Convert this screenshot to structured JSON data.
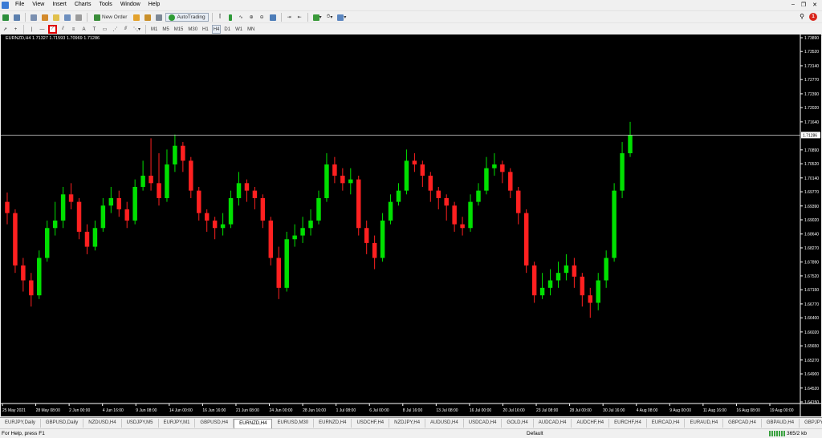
{
  "menu": [
    "File",
    "View",
    "Insert",
    "Charts",
    "Tools",
    "Window",
    "Help"
  ],
  "toolbar": {
    "new_order": "New Order",
    "autotrading": "AutoTrading"
  },
  "timeframes": [
    "M1",
    "M5",
    "M15",
    "M30",
    "H1",
    "H4",
    "D1",
    "W1",
    "MN"
  ],
  "chart": {
    "header": "EURNZD,H4  1.71327 1.71593 1.70969 1.71286",
    "current_price_label": "1.71286",
    "current_price": 1.71286,
    "colors": {
      "bull": "#00e000",
      "bear": "#ff2020",
      "line": "#d9d9d9",
      "bg": "#000000"
    }
  },
  "notifications": {
    "count": "1"
  },
  "chart_data": {
    "type": "candlestick",
    "ylim": [
      1.6415,
      1.7389
    ],
    "y_ticks": [
      "1.73890",
      "1.73520",
      "1.73140",
      "1.72770",
      "1.72390",
      "1.72020",
      "1.71640",
      "1.70890",
      "1.70520",
      "1.70140",
      "1.69770",
      "1.69390",
      "1.69020",
      "1.68640",
      "1.68270",
      "1.67890",
      "1.67520",
      "1.67150",
      "1.66770",
      "1.66400",
      "1.66020",
      "1.65650",
      "1.65270",
      "1.64900",
      "1.64520",
      "1.64150"
    ],
    "x_ticks": [
      "25 May 2021",
      "28 May 08:00",
      "2 Jun 00:00",
      "4 Jun 16:00",
      "9 Jun 08:00",
      "14 Jun 00:00",
      "16 Jun 16:00",
      "21 Jun 08:00",
      "24 Jun 00:00",
      "28 Jun 16:00",
      "1 Jul 08:00",
      "6 Jul 00:00",
      "8 Jul 16:00",
      "13 Jul 08:00",
      "16 Jul 00:00",
      "20 Jul 16:00",
      "23 Jul 08:00",
      "28 Jul 00:00",
      "30 Jul 16:00",
      "4 Aug 08:00",
      "9 Aug 00:00",
      "11 Aug 16:00",
      "16 Aug 08:00",
      "19 Aug 00:00"
    ],
    "closes": [
      1.692,
      1.678,
      1.674,
      1.67,
      1.68,
      1.688,
      1.69,
      1.697,
      1.695,
      1.687,
      1.683,
      1.688,
      1.694,
      1.696,
      1.693,
      1.69,
      1.699,
      1.702,
      1.7,
      1.696,
      1.705,
      1.71,
      1.706,
      1.698,
      1.692,
      1.69,
      1.688,
      1.689,
      1.696,
      1.7,
      1.698,
      1.696,
      1.69,
      1.68,
      1.672,
      1.685,
      1.686,
      1.688,
      1.69,
      1.696,
      1.705,
      1.702,
      1.7,
      1.701,
      1.688,
      1.684,
      1.68,
      1.69,
      1.695,
      1.698,
      1.706,
      1.705,
      1.702,
      1.698,
      1.696,
      1.694,
      1.689,
      1.688,
      1.695,
      1.698,
      1.704,
      1.705,
      1.703,
      1.698,
      1.692,
      1.678,
      1.67,
      1.672,
      1.674,
      1.676,
      1.678,
      1.675,
      1.67,
      1.668,
      1.674,
      1.68,
      1.698,
      1.708,
      1.7128
    ],
    "candles": [
      [
        1.695,
        1.692,
        1.6975,
        1.689
      ],
      [
        1.692,
        1.678,
        1.693,
        1.676
      ],
      [
        1.678,
        1.674,
        1.68,
        1.671
      ],
      [
        1.674,
        1.67,
        1.676,
        1.667
      ],
      [
        1.67,
        1.68,
        1.682,
        1.669
      ],
      [
        1.68,
        1.688,
        1.69,
        1.679
      ],
      [
        1.688,
        1.69,
        1.695,
        1.686
      ],
      [
        1.69,
        1.697,
        1.699,
        1.688
      ],
      [
        1.697,
        1.695,
        1.7,
        1.693
      ],
      [
        1.695,
        1.687,
        1.696,
        1.685
      ],
      [
        1.687,
        1.683,
        1.689,
        1.681
      ],
      [
        1.683,
        1.688,
        1.69,
        1.682
      ],
      [
        1.688,
        1.694,
        1.696,
        1.687
      ],
      [
        1.694,
        1.696,
        1.699,
        1.692
      ],
      [
        1.696,
        1.693,
        1.698,
        1.691
      ],
      [
        1.693,
        1.69,
        1.695,
        1.688
      ],
      [
        1.69,
        1.699,
        1.701,
        1.689
      ],
      [
        1.699,
        1.702,
        1.706,
        1.698
      ],
      [
        1.702,
        1.7,
        1.712,
        1.698
      ],
      [
        1.7,
        1.696,
        1.708,
        1.694
      ],
      [
        1.696,
        1.705,
        1.709,
        1.695
      ],
      [
        1.705,
        1.71,
        1.713,
        1.703
      ],
      [
        1.71,
        1.706,
        1.711,
        1.703
      ],
      [
        1.706,
        1.698,
        1.707,
        1.696
      ],
      [
        1.698,
        1.692,
        1.699,
        1.69
      ],
      [
        1.692,
        1.69,
        1.693,
        1.687
      ],
      [
        1.69,
        1.688,
        1.691,
        1.685
      ],
      [
        1.688,
        1.689,
        1.692,
        1.686
      ],
      [
        1.689,
        1.696,
        1.698,
        1.688
      ],
      [
        1.696,
        1.7,
        1.703,
        1.694
      ],
      [
        1.7,
        1.698,
        1.701,
        1.695
      ],
      [
        1.698,
        1.696,
        1.699,
        1.693
      ],
      [
        1.696,
        1.69,
        1.697,
        1.688
      ],
      [
        1.69,
        1.68,
        1.691,
        1.678
      ],
      [
        1.68,
        1.672,
        1.683,
        1.669
      ],
      [
        1.672,
        1.685,
        1.687,
        1.671
      ],
      [
        1.685,
        1.686,
        1.689,
        1.683
      ],
      [
        1.686,
        1.688,
        1.691,
        1.684
      ],
      [
        1.688,
        1.69,
        1.693,
        1.686
      ],
      [
        1.69,
        1.696,
        1.698,
        1.689
      ],
      [
        1.696,
        1.705,
        1.708,
        1.695
      ],
      [
        1.705,
        1.702,
        1.707,
        1.7
      ],
      [
        1.702,
        1.7,
        1.704,
        1.698
      ],
      [
        1.7,
        1.701,
        1.704,
        1.697
      ],
      [
        1.701,
        1.688,
        1.702,
        1.686
      ],
      [
        1.688,
        1.684,
        1.69,
        1.681
      ],
      [
        1.684,
        1.68,
        1.686,
        1.677
      ],
      [
        1.68,
        1.69,
        1.692,
        1.679
      ],
      [
        1.69,
        1.695,
        1.697,
        1.689
      ],
      [
        1.695,
        1.698,
        1.7,
        1.694
      ],
      [
        1.698,
        1.706,
        1.709,
        1.697
      ],
      [
        1.706,
        1.705,
        1.708,
        1.703
      ],
      [
        1.705,
        1.702,
        1.706,
        1.699
      ],
      [
        1.702,
        1.698,
        1.703,
        1.695
      ],
      [
        1.698,
        1.696,
        1.699,
        1.693
      ],
      [
        1.696,
        1.694,
        1.697,
        1.69
      ],
      [
        1.694,
        1.689,
        1.695,
        1.687
      ],
      [
        1.689,
        1.688,
        1.691,
        1.686
      ],
      [
        1.688,
        1.695,
        1.697,
        1.687
      ],
      [
        1.695,
        1.698,
        1.7,
        1.694
      ],
      [
        1.698,
        1.704,
        1.707,
        1.697
      ],
      [
        1.704,
        1.705,
        1.708,
        1.702
      ],
      [
        1.705,
        1.703,
        1.706,
        1.7
      ],
      [
        1.703,
        1.698,
        1.704,
        1.696
      ],
      [
        1.698,
        1.692,
        1.699,
        1.689
      ],
      [
        1.692,
        1.678,
        1.693,
        1.676
      ],
      [
        1.678,
        1.67,
        1.679,
        1.668
      ],
      [
        1.67,
        1.672,
        1.676,
        1.669
      ],
      [
        1.672,
        1.674,
        1.677,
        1.67
      ],
      [
        1.674,
        1.676,
        1.679,
        1.672
      ],
      [
        1.676,
        1.678,
        1.681,
        1.674
      ],
      [
        1.678,
        1.675,
        1.68,
        1.672
      ],
      [
        1.675,
        1.67,
        1.676,
        1.667
      ],
      [
        1.67,
        1.668,
        1.672,
        1.664
      ],
      [
        1.668,
        1.674,
        1.676,
        1.666
      ],
      [
        1.674,
        1.68,
        1.682,
        1.672
      ],
      [
        1.68,
        1.698,
        1.7,
        1.679
      ],
      [
        1.698,
        1.708,
        1.711,
        1.696
      ],
      [
        1.708,
        1.7128,
        1.7164,
        1.707
      ]
    ]
  },
  "tabs": [
    "EURJPY,Daily",
    "GBPUSD,Daily",
    "NZDUSD,H4",
    "USDJPY,M5",
    "EURJPY,M1",
    "GBPUSD,H4",
    "EURNZD,H4",
    "EURUSD,M30",
    "EURNZD,H4",
    "USDCHF,H4",
    "NZDJPY,H4",
    "AUDUSD,H4",
    "USDCAD,H4",
    "GOLD,H4",
    "AUDCAD,H4",
    "AUDCHF,H4",
    "EURCHF,H4",
    "EURCAD,H4",
    "EURAUD,H4",
    "GBPCAD,H4",
    "GBPAUD,H4",
    "GBPJPY,H4"
  ],
  "active_tab": 6,
  "status": {
    "help": "For Help, press F1",
    "profile": "Default",
    "traffic": "365/2 kb"
  }
}
